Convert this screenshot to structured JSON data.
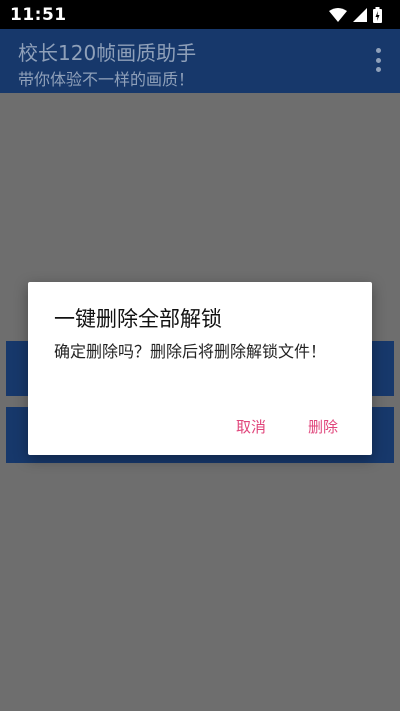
{
  "status_bar": {
    "time": "11:51",
    "icons": [
      "wifi-icon",
      "signal-icon",
      "battery-icon"
    ]
  },
  "app_bar": {
    "title": "校长120帧画质助手",
    "subtitle": "带你体验不一样的画质！",
    "menu_icon": "more-vert-icon"
  },
  "dialog": {
    "title": "一键删除全部解锁",
    "message": "确定删除吗？删除后将删除解锁文件！",
    "cancel_label": "取消",
    "confirm_label": "删除"
  },
  "colors": {
    "app_bar": "#17386b",
    "scrim": "#6e6e6e",
    "accent": "#e0457b",
    "status_bar": "#000000"
  }
}
